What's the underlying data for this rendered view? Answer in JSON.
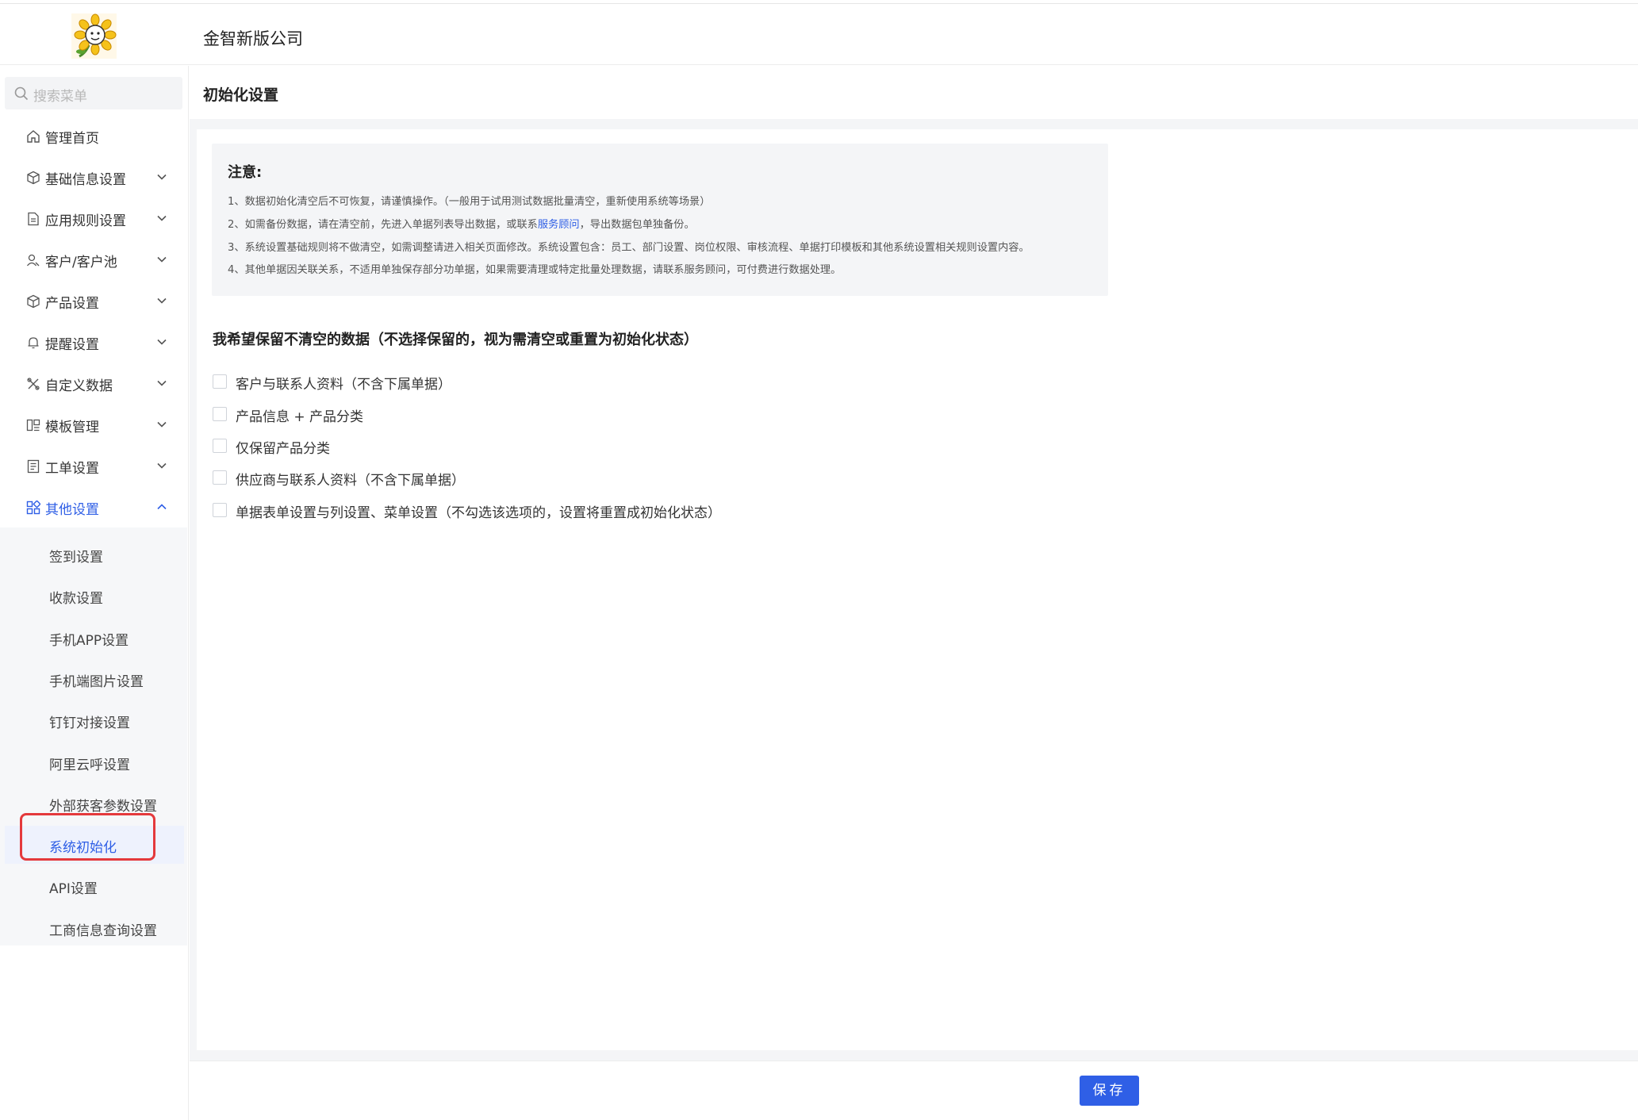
{
  "header": {
    "company_name": "金智新版公司"
  },
  "sidebar": {
    "search_placeholder": "搜索菜单",
    "items": [
      {
        "label": "管理首页",
        "icon": "home-icon",
        "has_chevron": false
      },
      {
        "label": "基础信息设置",
        "icon": "cube-icon",
        "has_chevron": true
      },
      {
        "label": "应用规则设置",
        "icon": "document-icon",
        "has_chevron": true
      },
      {
        "label": "客户/客户池",
        "icon": "user-icon",
        "has_chevron": true
      },
      {
        "label": "产品设置",
        "icon": "box-icon",
        "has_chevron": true
      },
      {
        "label": "提醒设置",
        "icon": "bell-icon",
        "has_chevron": true
      },
      {
        "label": "自定义数据",
        "icon": "tools-icon",
        "has_chevron": true
      },
      {
        "label": "模板管理",
        "icon": "template-icon",
        "has_chevron": true
      },
      {
        "label": "工单设置",
        "icon": "workorder-icon",
        "has_chevron": true
      },
      {
        "label": "其他设置",
        "icon": "grid-icon",
        "has_chevron": true,
        "expanded": true
      }
    ],
    "submenu": [
      {
        "label": "签到设置"
      },
      {
        "label": "收款设置"
      },
      {
        "label": "手机APP设置"
      },
      {
        "label": "手机端图片设置"
      },
      {
        "label": "钉钉对接设置"
      },
      {
        "label": "阿里云呼设置"
      },
      {
        "label": "外部获客参数设置"
      },
      {
        "label": "系统初始化",
        "selected": true
      },
      {
        "label": "API设置"
      },
      {
        "label": "工商信息查询设置"
      }
    ]
  },
  "main": {
    "page_title": "初始化设置",
    "notice": {
      "title": "注意:",
      "line1": "1、数据初始化清空后不可恢复，请谨慎操作。（一般用于试用测试数据批量清空，重新使用系统等场景）",
      "line2_before": "2、如需备份数据，请在清空前，先进入单据列表导出数据，或联系",
      "line2_link": "服务顾问",
      "line2_after": "，导出数据包单独备份。",
      "line3": "3、系统设置基础规则将不做清空，如需调整请进入相关页面修改。系统设置包含：员工、部门设置、岗位权限、审核流程、单据打印模板和其他系统设置相关规则设置内容。",
      "line4": "4、其他单据因关联关系，不适用单独保存部分功单据，如果需要清理或特定批量处理数据，请联系服务顾问，可付费进行数据处理。"
    },
    "section_title": "我希望保留不清空的数据（不选择保留的，视为需清空或重置为初始化状态）",
    "options": [
      {
        "label": "客户与联系人资料（不含下属单据）",
        "checked": false
      },
      {
        "label": "产品信息 + 产品分类",
        "checked": false
      },
      {
        "label": "仅保留产品分类",
        "checked": false
      },
      {
        "label": "供应商与联系人资料（不含下属单据）",
        "checked": false
      },
      {
        "label": "单据表单设置与列设置、菜单设置（不勾选该选项的，设置将重置成初始化状态）",
        "checked": false
      }
    ],
    "save_label": "保存"
  },
  "colors": {
    "accent": "#2f5fe6",
    "highlight_box": "#e4393c"
  }
}
